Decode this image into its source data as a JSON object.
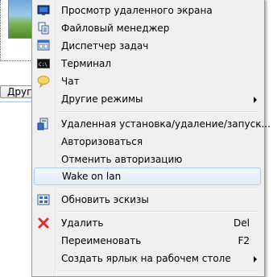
{
  "background": {
    "other_modes_button": "Други"
  },
  "menu": {
    "items": [
      {
        "label": "Просмотр удаленного экрана",
        "icon": "monitor-icon"
      },
      {
        "label": "Файловый менеджер",
        "icon": "file-manager-icon"
      },
      {
        "label": "Диспетчер задач",
        "icon": "task-manager-icon"
      },
      {
        "label": "Терминал",
        "icon": "terminal-icon"
      },
      {
        "label": "Чат",
        "icon": "chat-icon"
      },
      {
        "label": "Другие режимы",
        "icon": "",
        "submenu": true
      },
      {
        "label": "Удаленная установка/удаление/запуск...",
        "icon": "install-icon"
      },
      {
        "label": "Авторизоваться",
        "icon": ""
      },
      {
        "label": "Отменить авторизацию",
        "icon": ""
      },
      {
        "label": "Wake on lan",
        "icon": "",
        "highlighted": true
      },
      {
        "label": "Обновить эскизы",
        "icon": "refresh-thumbnails-icon"
      },
      {
        "label": "Удалить",
        "icon": "delete-icon",
        "shortcut": "Del"
      },
      {
        "label": "Переименовать",
        "icon": "",
        "shortcut": "F2"
      },
      {
        "label": "Создать ярлык на рабочем столе",
        "icon": "",
        "submenu": true
      }
    ]
  },
  "colors": {
    "hover_border": "#aecff7",
    "delete_icon": "#d9302a",
    "menu_background": "#f0f0f0"
  }
}
